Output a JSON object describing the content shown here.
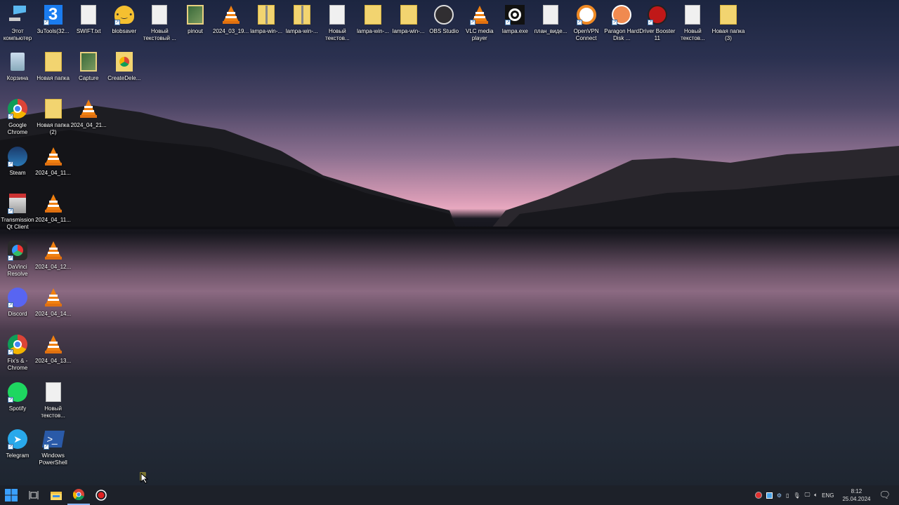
{
  "desktop": {
    "icons": [
      {
        "label": "Этот компьютер",
        "type": "pc",
        "col": 0,
        "row": 0
      },
      {
        "label": "3uTools(32...",
        "type": "3u",
        "col": 1,
        "row": 0,
        "shortcut": true
      },
      {
        "label": "SWIFT.txt",
        "type": "file",
        "col": 2,
        "row": 0
      },
      {
        "label": "blobsaver",
        "type": "blob",
        "col": 3,
        "row": 0,
        "shortcut": true
      },
      {
        "label": "Новый текстовый ...",
        "type": "file",
        "col": 4,
        "row": 0
      },
      {
        "label": "pinout",
        "type": "folderimg",
        "col": 5,
        "row": 0
      },
      {
        "label": "2024_03_19...",
        "type": "vlc",
        "col": 6,
        "row": 0
      },
      {
        "label": "lampa-win-...",
        "type": "zip",
        "col": 7,
        "row": 0
      },
      {
        "label": "lampa-win-...",
        "type": "zip",
        "col": 8,
        "row": 0
      },
      {
        "label": "Новый текстов...",
        "type": "file",
        "col": 9,
        "row": 0
      },
      {
        "label": "lampa-win-...",
        "type": "folder",
        "col": 10,
        "row": 0
      },
      {
        "label": "lampa-win-...",
        "type": "folder",
        "col": 11,
        "row": 0
      },
      {
        "label": "OBS Studio",
        "type": "obs",
        "col": 12,
        "row": 0
      },
      {
        "label": "VLC media player",
        "type": "vlc",
        "col": 13,
        "row": 0,
        "shortcut": true
      },
      {
        "label": "lampa.exe",
        "type": "lampa",
        "col": 14,
        "row": 0,
        "shortcut": true
      },
      {
        "label": "план_виде...",
        "type": "file",
        "col": 15,
        "row": 0
      },
      {
        "label": "OpenVPN Connect",
        "type": "openvpn",
        "col": 16,
        "row": 0,
        "shortcut": true
      },
      {
        "label": "Paragon Hard Disk ...",
        "type": "paragon",
        "col": 17,
        "row": 0,
        "shortcut": true
      },
      {
        "label": "Driver Booster 11",
        "type": "driver",
        "col": 18,
        "row": 0,
        "shortcut": true
      },
      {
        "label": "Новый текстов...",
        "type": "file",
        "col": 19,
        "row": 0
      },
      {
        "label": "Новая папка (3)",
        "type": "folder",
        "col": 20,
        "row": 0
      },
      {
        "label": "Корзина",
        "type": "bin",
        "col": 0,
        "row": 1
      },
      {
        "label": "Новая папка",
        "type": "folder",
        "col": 1,
        "row": 1
      },
      {
        "label": "Capture",
        "type": "folderimg",
        "col": 2,
        "row": 1
      },
      {
        "label": "CreateDele...",
        "type": "folderchrome",
        "col": 3,
        "row": 1
      },
      {
        "label": "Google Chrome",
        "type": "chrome",
        "col": 0,
        "row": 2,
        "shortcut": true
      },
      {
        "label": "Новая папка (2)",
        "type": "folder",
        "col": 1,
        "row": 2
      },
      {
        "label": "2024_04_21...",
        "type": "vlc",
        "col": 2,
        "row": 2
      },
      {
        "label": "Steam",
        "type": "steam",
        "col": 0,
        "row": 3,
        "shortcut": true
      },
      {
        "label": "2024_04_11...",
        "type": "vlc",
        "col": 1,
        "row": 3
      },
      {
        "label": "Transmission Qt Client",
        "type": "transmission",
        "col": 0,
        "row": 4,
        "shortcut": true
      },
      {
        "label": "2024_04_11...",
        "type": "vlc",
        "col": 1,
        "row": 4
      },
      {
        "label": "DaVinci Resolve",
        "type": "davinci",
        "col": 0,
        "row": 5,
        "shortcut": true
      },
      {
        "label": "2024_04_12...",
        "type": "vlc",
        "col": 1,
        "row": 5
      },
      {
        "label": "Discord",
        "type": "discord",
        "col": 0,
        "row": 6,
        "shortcut": true
      },
      {
        "label": "2024_04_14...",
        "type": "vlc",
        "col": 1,
        "row": 6
      },
      {
        "label": "Fix's & - Chrome",
        "type": "chrome",
        "col": 0,
        "row": 7,
        "shortcut": true
      },
      {
        "label": "2024_04_13...",
        "type": "vlc",
        "col": 1,
        "row": 7
      },
      {
        "label": "Spotify",
        "type": "spotify",
        "col": 0,
        "row": 8,
        "shortcut": true
      },
      {
        "label": "Новый текстов...",
        "type": "file",
        "col": 1,
        "row": 8
      },
      {
        "label": "Telegram",
        "type": "telegram",
        "col": 0,
        "row": 9,
        "shortcut": true
      },
      {
        "label": "Windows PowerShell",
        "type": "powershell",
        "col": 1,
        "row": 9,
        "shortcut": true
      }
    ]
  },
  "taskbar": {
    "apps": [
      "start",
      "task-view",
      "file-explorer",
      "chrome",
      "obs-recording"
    ],
    "tray": {
      "language": "ENG",
      "time": "8:12",
      "date": "25.04.2024"
    }
  }
}
